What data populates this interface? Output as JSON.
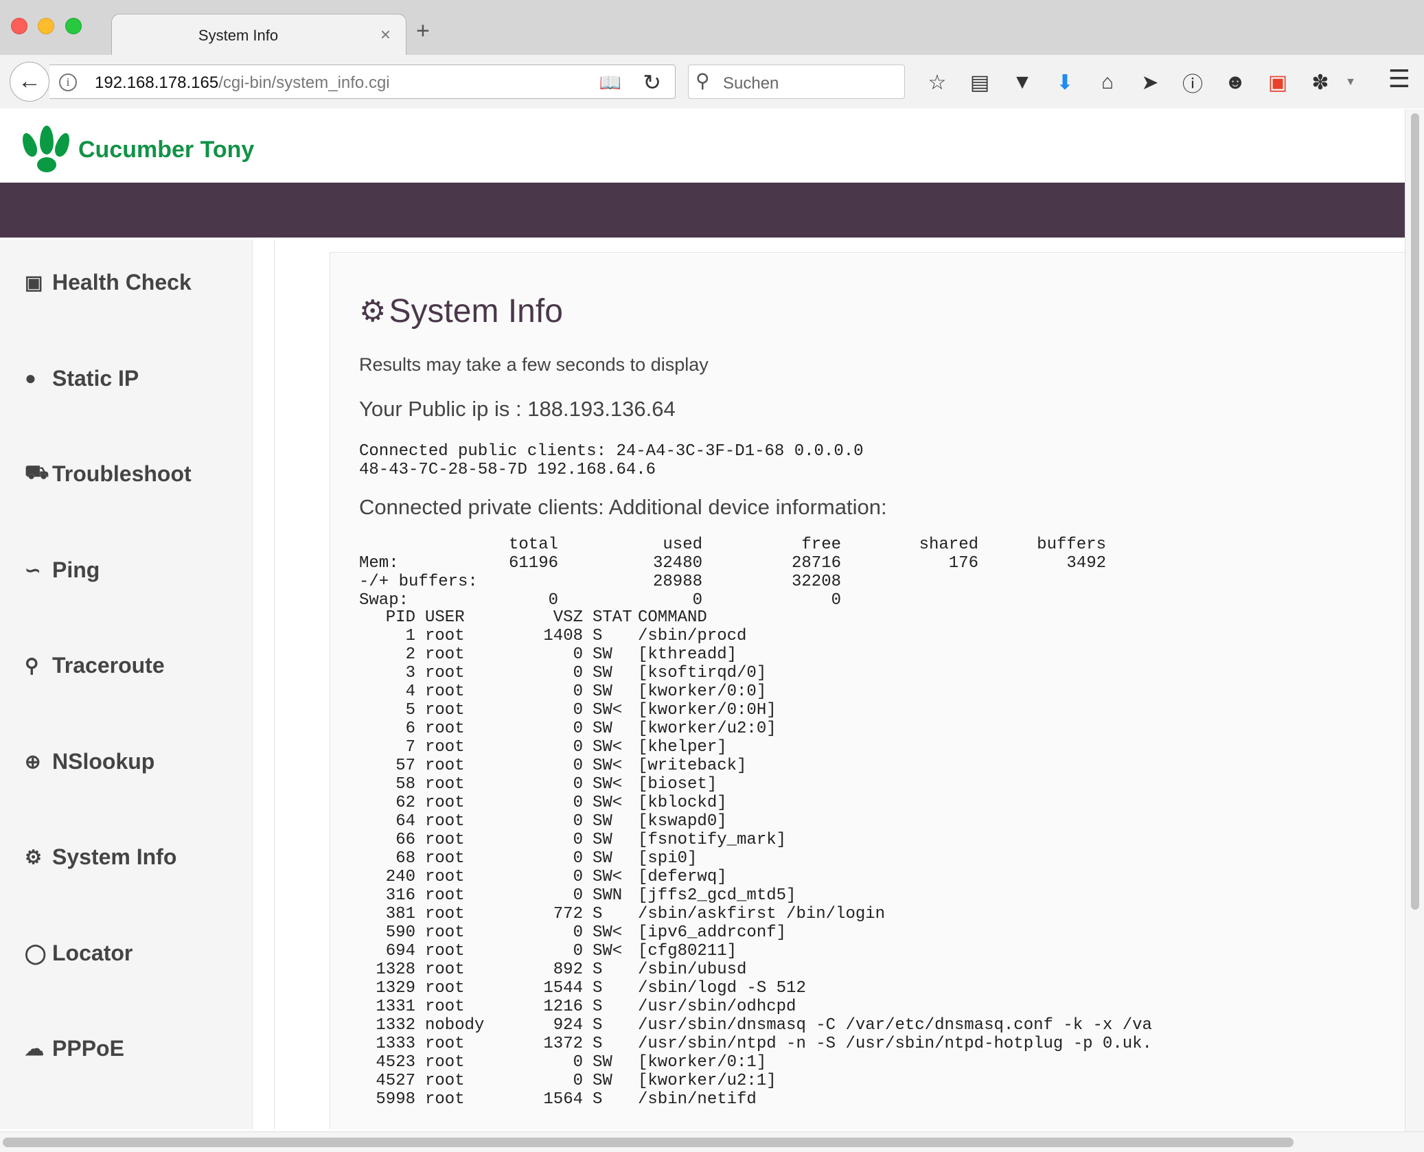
{
  "browser": {
    "tab_title": "System Info",
    "tab_close": "×",
    "new_tab": "+",
    "url_host": "192.168.178.165",
    "url_path": "/cgi-bin/system_info.cgi",
    "search_placeholder": "Suchen"
  },
  "brand": {
    "name": "Cucumber Tony",
    "color": "#129246",
    "band_color": "#4a384a"
  },
  "sidebar": {
    "items": [
      {
        "label": "Health Check",
        "icon": "medkit-icon"
      },
      {
        "label": "Static IP",
        "icon": "globe-icon"
      },
      {
        "label": "Troubleshoot",
        "icon": "ambulance-icon"
      },
      {
        "label": "Ping",
        "icon": "rss-icon"
      },
      {
        "label": "Traceroute",
        "icon": "map-marker-icon"
      },
      {
        "label": "NSlookup",
        "icon": "search-plus-icon"
      },
      {
        "label": "System Info",
        "icon": "gears-icon"
      },
      {
        "label": "Locator",
        "icon": "lightbulb-icon"
      },
      {
        "label": "PPPoE",
        "icon": "cloud-upload-icon"
      }
    ]
  },
  "main": {
    "title": "System Info",
    "subtitle": "Results may take a few seconds to display",
    "public_ip": "Your Public ip is : 188.193.136.64",
    "public_clients_line1": "Connected public clients: 24-A4-3C-3F-D1-68 0.0.0.0",
    "public_clients_line2": "48-43-7C-28-58-7D 192.168.64.6",
    "private_clients": "Connected private clients: Additional device information:",
    "memory": {
      "header": [
        "",
        "total",
        "used",
        "free",
        "shared",
        "buffers"
      ],
      "rows": [
        [
          "Mem:",
          "61196",
          "32480",
          "28716",
          "176",
          "3492"
        ],
        [
          "-/+ buffers:",
          "",
          "28988",
          "32208",
          "",
          ""
        ],
        [
          "Swap:",
          "0",
          "0",
          "0",
          "",
          ""
        ]
      ]
    },
    "processes": {
      "header": [
        "PID",
        "USER",
        "VSZ",
        "STAT",
        "COMMAND"
      ],
      "rows": [
        [
          "1",
          "root",
          "1408",
          "S",
          "/sbin/procd"
        ],
        [
          "2",
          "root",
          "0",
          "SW",
          "[kthreadd]"
        ],
        [
          "3",
          "root",
          "0",
          "SW",
          "[ksoftirqd/0]"
        ],
        [
          "4",
          "root",
          "0",
          "SW",
          "[kworker/0:0]"
        ],
        [
          "5",
          "root",
          "0",
          "SW<",
          "[kworker/0:0H]"
        ],
        [
          "6",
          "root",
          "0",
          "SW",
          "[kworker/u2:0]"
        ],
        [
          "7",
          "root",
          "0",
          "SW<",
          "[khelper]"
        ],
        [
          "57",
          "root",
          "0",
          "SW<",
          "[writeback]"
        ],
        [
          "58",
          "root",
          "0",
          "SW<",
          "[bioset]"
        ],
        [
          "62",
          "root",
          "0",
          "SW<",
          "[kblockd]"
        ],
        [
          "64",
          "root",
          "0",
          "SW",
          "[kswapd0]"
        ],
        [
          "66",
          "root",
          "0",
          "SW",
          "[fsnotify_mark]"
        ],
        [
          "68",
          "root",
          "0",
          "SW",
          "[spi0]"
        ],
        [
          "240",
          "root",
          "0",
          "SW<",
          "[deferwq]"
        ],
        [
          "316",
          "root",
          "0",
          "SWN",
          "[jffs2_gcd_mtd5]"
        ],
        [
          "381",
          "root",
          "772",
          "S",
          "/sbin/askfirst /bin/login"
        ],
        [
          "590",
          "root",
          "0",
          "SW<",
          "[ipv6_addrconf]"
        ],
        [
          "694",
          "root",
          "0",
          "SW<",
          "[cfg80211]"
        ],
        [
          "1328",
          "root",
          "892",
          "S",
          "/sbin/ubusd"
        ],
        [
          "1329",
          "root",
          "1544",
          "S",
          "/sbin/logd -S 512"
        ],
        [
          "1331",
          "root",
          "1216",
          "S",
          "/usr/sbin/odhcpd"
        ],
        [
          "1332",
          "nobody",
          "924",
          "S",
          "/usr/sbin/dnsmasq -C /var/etc/dnsmasq.conf -k -x /va"
        ],
        [
          "1333",
          "root",
          "1372",
          "S",
          "/usr/sbin/ntpd -n -S /usr/sbin/ntpd-hotplug -p 0.uk."
        ],
        [
          "4523",
          "root",
          "0",
          "SW",
          "[kworker/0:1]"
        ],
        [
          "4527",
          "root",
          "0",
          "SW",
          "[kworker/u2:1]"
        ],
        [
          "5998",
          "root",
          "1564",
          "S",
          "/sbin/netifd"
        ]
      ]
    }
  }
}
